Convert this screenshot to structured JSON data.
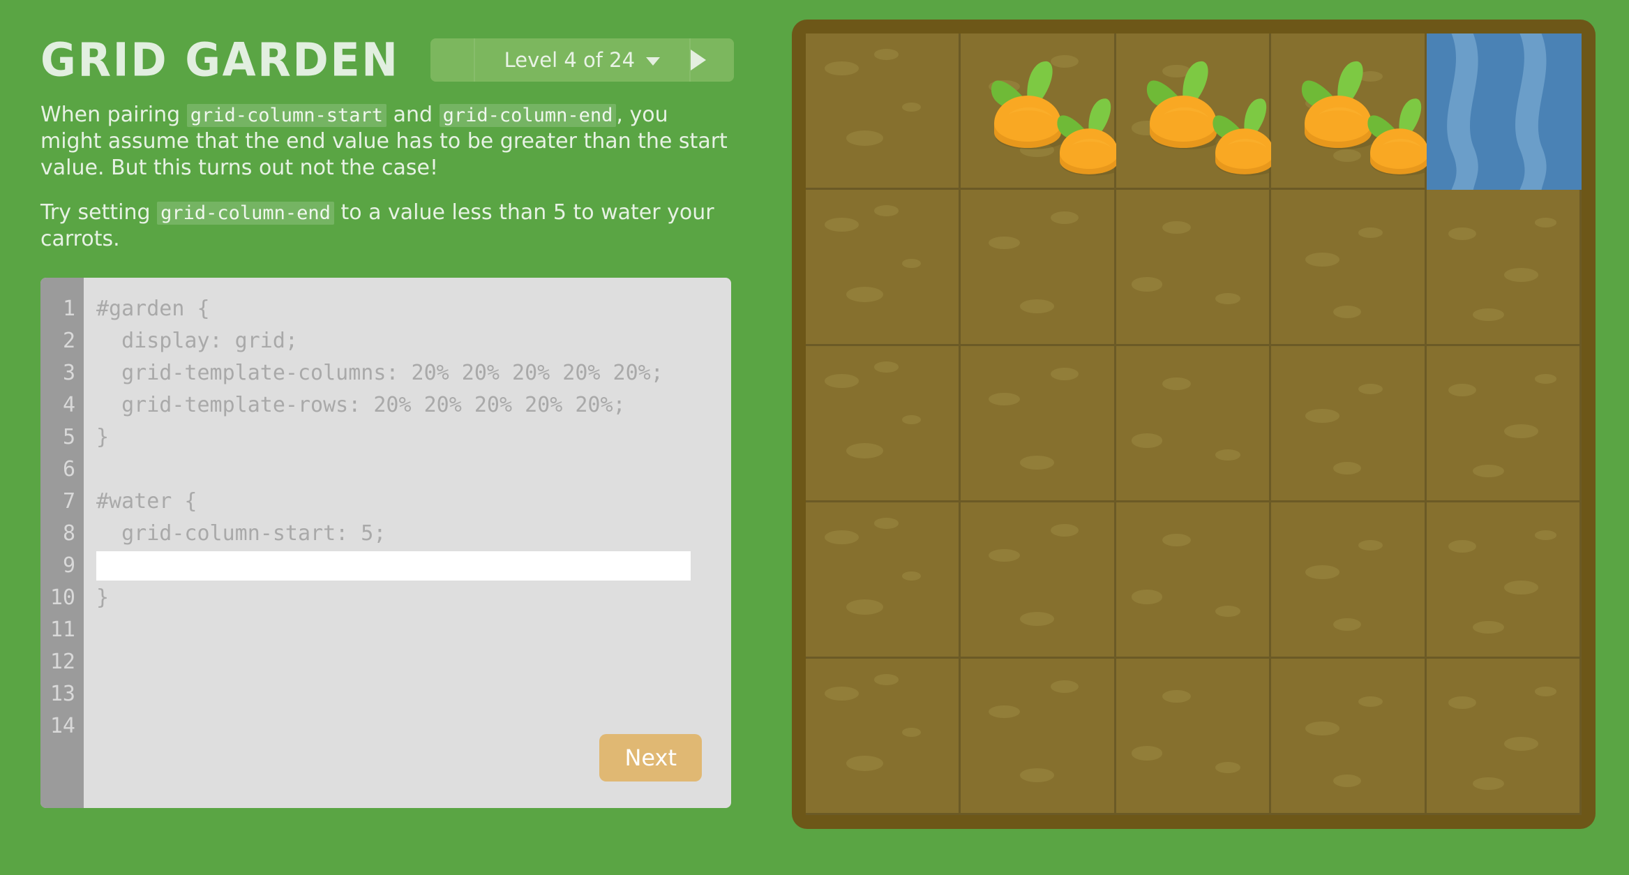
{
  "app": {
    "title": "GRID GARDEN",
    "background_color": "#5aa544"
  },
  "level_selector": {
    "prev_icon": "triangle-left-icon",
    "next_icon": "triangle-right-icon",
    "label": "Level 4 of 24",
    "caret_icon": "chevron-down-icon",
    "current_level": 4,
    "total_levels": 24
  },
  "instructions": {
    "p1_part1": "When pairing ",
    "p1_code1": "grid-column-start",
    "p1_part2": " and ",
    "p1_code2": "grid-column-end",
    "p1_part3": ", you might assume that the end value has to be greater than the start value. But this turns out not the case!",
    "p2_part1": "Try setting ",
    "p2_code1": "grid-column-end",
    "p2_part2": " to a value less than 5 to water your carrots."
  },
  "editor": {
    "line_numbers": [
      "1",
      "2",
      "3",
      "4",
      "5",
      "6",
      "7",
      "8",
      "9",
      "10",
      "11",
      "12",
      "13",
      "14"
    ],
    "lines": [
      "#garden {",
      "  display: grid;",
      "  grid-template-columns: 20% 20% 20% 20% 20%;",
      "  grid-template-rows: 20% 20% 20% 20% 20%;",
      "}",
      "",
      "#water {",
      "  grid-column-start: 5;",
      "",
      "}",
      "",
      "",
      "",
      ""
    ],
    "input_line_index": 8,
    "input_value": "",
    "input_placeholder": "",
    "next_label": "Next",
    "next_color": "#e0b873",
    "gutter_color": "#9b9b9b",
    "background_color": "#dedede"
  },
  "garden": {
    "rows": 5,
    "columns": 5,
    "dirt_color": "#86702e",
    "frame_color": "#6d5718",
    "water_color": "#4a82b5",
    "carrot_color": "#f5a623",
    "cells": [
      {
        "row": 1,
        "col": 1,
        "type": "dirt"
      },
      {
        "row": 1,
        "col": 2,
        "type": "carrot"
      },
      {
        "row": 1,
        "col": 3,
        "type": "carrot"
      },
      {
        "row": 1,
        "col": 4,
        "type": "carrot"
      },
      {
        "row": 1,
        "col": 5,
        "type": "water"
      },
      {
        "row": 2,
        "col": 1,
        "type": "dirt"
      },
      {
        "row": 2,
        "col": 2,
        "type": "dirt"
      },
      {
        "row": 2,
        "col": 3,
        "type": "dirt"
      },
      {
        "row": 2,
        "col": 4,
        "type": "dirt"
      },
      {
        "row": 2,
        "col": 5,
        "type": "dirt"
      },
      {
        "row": 3,
        "col": 1,
        "type": "dirt"
      },
      {
        "row": 3,
        "col": 2,
        "type": "dirt"
      },
      {
        "row": 3,
        "col": 3,
        "type": "dirt"
      },
      {
        "row": 3,
        "col": 4,
        "type": "dirt"
      },
      {
        "row": 3,
        "col": 5,
        "type": "dirt"
      },
      {
        "row": 4,
        "col": 1,
        "type": "dirt"
      },
      {
        "row": 4,
        "col": 2,
        "type": "dirt"
      },
      {
        "row": 4,
        "col": 3,
        "type": "dirt"
      },
      {
        "row": 4,
        "col": 4,
        "type": "dirt"
      },
      {
        "row": 4,
        "col": 5,
        "type": "dirt"
      },
      {
        "row": 5,
        "col": 1,
        "type": "dirt"
      },
      {
        "row": 5,
        "col": 2,
        "type": "dirt"
      },
      {
        "row": 5,
        "col": 3,
        "type": "dirt"
      },
      {
        "row": 5,
        "col": 4,
        "type": "dirt"
      },
      {
        "row": 5,
        "col": 5,
        "type": "dirt"
      }
    ]
  }
}
